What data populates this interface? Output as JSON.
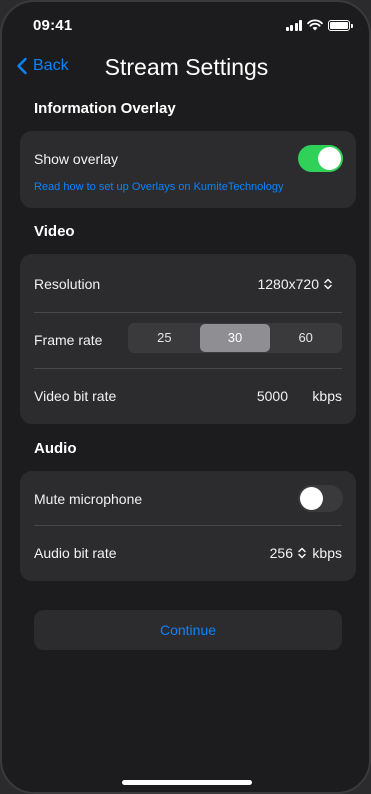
{
  "status_bar": {
    "time": "09:41"
  },
  "nav": {
    "back_label": "Back",
    "title": "Stream Settings"
  },
  "overlay_section": {
    "header": "Information Overlay",
    "show_overlay_label": "Show overlay",
    "show_overlay_on": true,
    "help_link": "Read how to set up Overlays on KumiteTechnology"
  },
  "video_section": {
    "header": "Video",
    "resolution_label": "Resolution",
    "resolution_value": "1280x720",
    "frame_rate_label": "Frame rate",
    "frame_rate_options": [
      "25",
      "30",
      "60"
    ],
    "frame_rate_selected": "30",
    "bit_rate_label": "Video bit rate",
    "bit_rate_value": "5000",
    "bit_rate_unit": "kbps"
  },
  "audio_section": {
    "header": "Audio",
    "mute_label": "Mute microphone",
    "mute_on": false,
    "bit_rate_label": "Audio bit rate",
    "bit_rate_value": "256",
    "bit_rate_unit": "kbps"
  },
  "footer": {
    "continue_label": "Continue"
  },
  "colors": {
    "accent": "#0a84ff",
    "toggle_on": "#30d158",
    "background": "#1c1c1e",
    "card": "#2c2c2e"
  }
}
